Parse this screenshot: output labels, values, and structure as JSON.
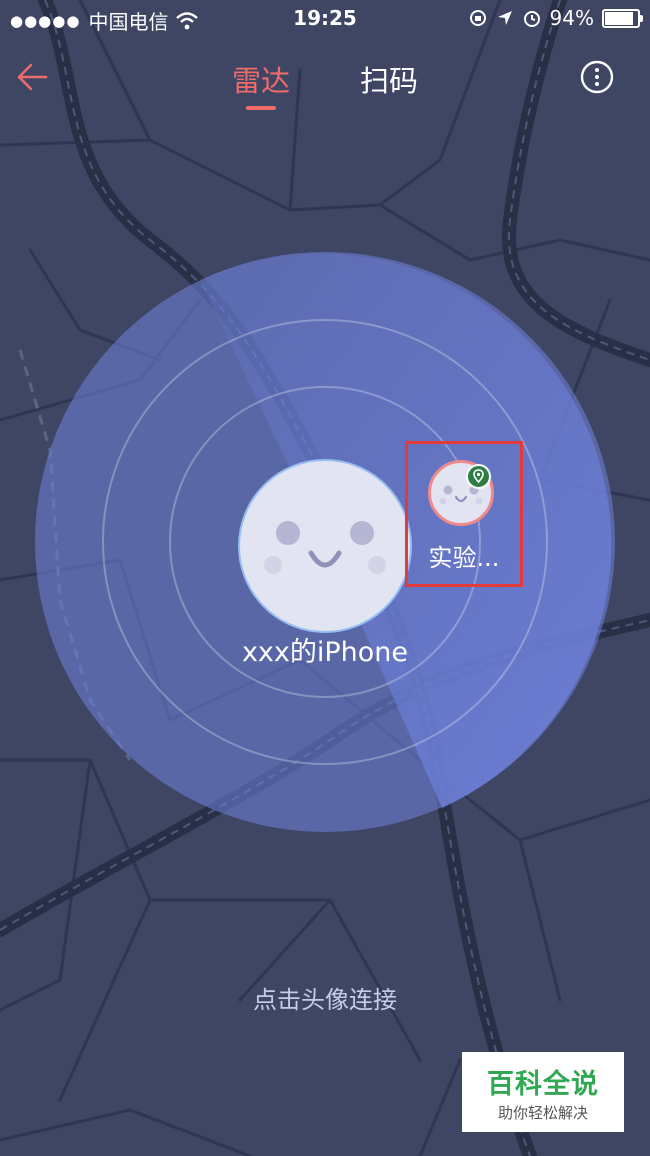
{
  "status_bar": {
    "signal_dots": "●●●●●",
    "carrier": "中国电信",
    "time": "19:25",
    "battery_text": "94%",
    "battery_level": 0.94
  },
  "nav": {
    "tabs": [
      {
        "label": "雷达",
        "active": true
      },
      {
        "label": "扫码",
        "active": false
      }
    ]
  },
  "radar": {
    "self_name": "xxx的iPhone",
    "peers": [
      {
        "name": "实验..."
      }
    ]
  },
  "hint": "点击头像连接",
  "watermark": {
    "title": "百科全说",
    "subtitle": "助你轻松解决"
  },
  "colors": {
    "background": "#3e4664",
    "accent": "#f06a6a",
    "radar_fill": "#6d7fd8",
    "highlight_box": "#e33b3b",
    "watermark_green": "#32a852"
  }
}
